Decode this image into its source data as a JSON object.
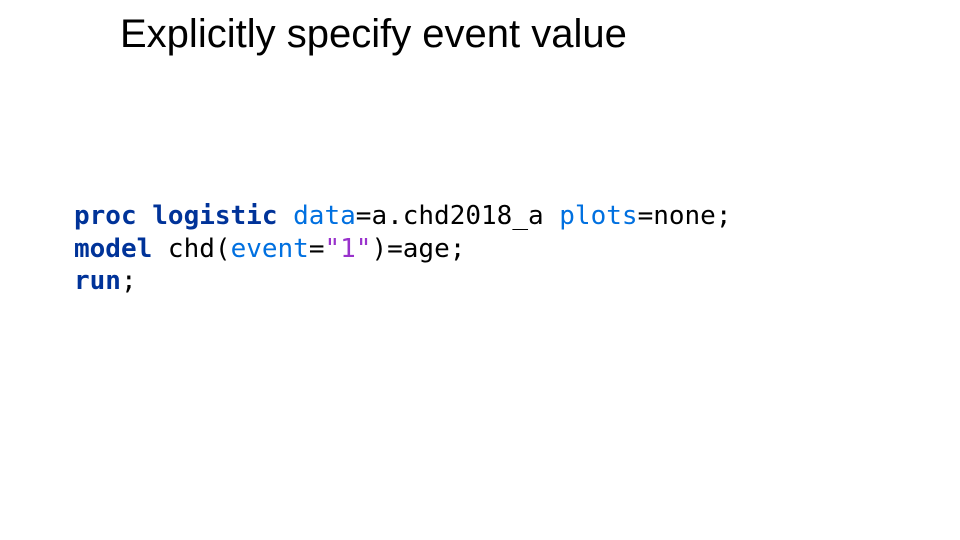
{
  "title": "Explicitly specify event value",
  "code": {
    "l1": {
      "proc_logistic": "proc logistic",
      "sp1": " ",
      "data_kw": "data",
      "eq1": "=",
      "dataset": "a.chd2018_a ",
      "plots_kw": "plots",
      "eq2": "=",
      "plots_val": "none",
      "semi": ";"
    },
    "l2": {
      "model": "model",
      "sp": " chd(",
      "event_kw": "event",
      "eq": "=",
      "event_val": "\"1\"",
      "rest": ")=age;"
    },
    "l3": {
      "run": "run",
      "semi": ";"
    }
  }
}
